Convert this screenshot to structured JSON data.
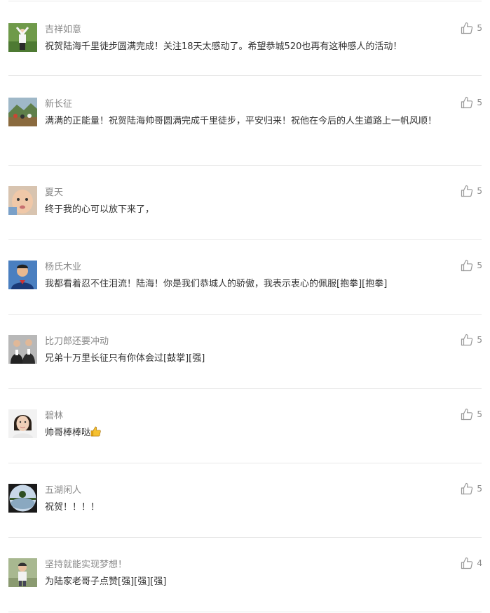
{
  "comments": [
    {
      "nickname": "吉祥如意",
      "content": "祝贺陆海千里徒步圆满完成！关注18天太感动了。希望恭城520也再有这种感人的活动！",
      "likes": "5",
      "avatar_icon": "person-arms-raised-avatar"
    },
    {
      "nickname": "新长征",
      "content": "满满的正能量！祝贺陆海帅哥圆满完成千里徒步，平安归来！祝他在今后的人生道路上一帆风顺！",
      "likes": "5",
      "avatar_icon": "landscape-group-avatar"
    },
    {
      "nickname": "夏天",
      "content": "终于我的心可以放下来了，",
      "likes": "5",
      "avatar_icon": "baby-face-avatar"
    },
    {
      "nickname": "杨氏木业",
      "content": "我都看着忍不住泪流！陆海！你是我们恭城人的骄傲，我表示衷心的佩服[抱拳][抱拳]",
      "likes": "5",
      "avatar_icon": "man-portrait-avatar"
    },
    {
      "nickname": "比刀郎还要冲动",
      "content": "兄弟十万里长征只有你体会过[鼓掌][强]",
      "likes": "5",
      "avatar_icon": "two-men-suits-avatar"
    },
    {
      "nickname": "碧林",
      "content": "帅哥棒棒哒",
      "content_emoji": "thumbs-up-emoji",
      "likes": "5",
      "avatar_icon": "woman-portrait-avatar"
    },
    {
      "nickname": "五湖闲人",
      "content": "祝贺！！！！",
      "likes": "5",
      "avatar_icon": "lake-tree-avatar"
    },
    {
      "nickname": "坚持就能实现梦想！",
      "content": "为陆家老哥子点赞[强][强][强]",
      "likes": "4",
      "avatar_icon": "child-outdoor-avatar"
    }
  ],
  "colors": {
    "nickname": "#888888",
    "content": "#333333",
    "divider": "#e8e8e8",
    "like_icon": "#999999"
  }
}
